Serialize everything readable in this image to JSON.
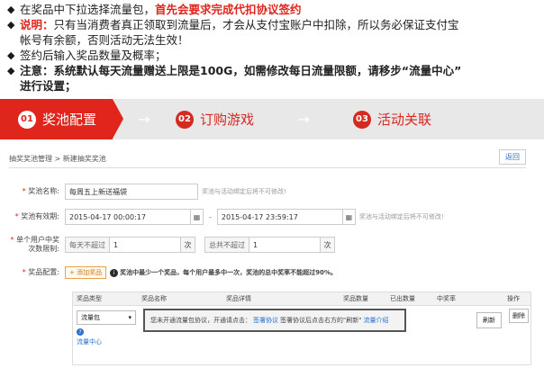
{
  "notes": {
    "n1_plain": "在奖品中下拉选择流量包，",
    "n1_red": "首先会要求完成代扣协议签约",
    "n2_label": "说明：",
    "n2_text": "只有当消费者真正领取到流量后，才会从支付宝账户中扣除，所以务必保证支付宝",
    "n2_text2": "帐号有余额，否则活动无法生效！",
    "n3_text": "签约后输入奖品数量及概率；",
    "n4_label": "注意：",
    "n4_text": "系统默认每天流量赠送上限是100G，如需修改每日流量限额，请移步“流量中心”",
    "n4_text2": "进行设置；"
  },
  "steps": [
    {
      "num": "01",
      "label": "奖池配置"
    },
    {
      "num": "02",
      "label": "订购游戏"
    },
    {
      "num": "03",
      "label": "活动关联"
    }
  ],
  "arrow": "→",
  "breadcrumb": {
    "text": "抽奖奖池管理 > 新建抽奖奖池",
    "back": "返回"
  },
  "form": {
    "name_label": "奖池名称:",
    "name_value": "每周五上新送福袋",
    "name_hint": "奖池与活动绑定后将不可修改!",
    "period_label": "奖池有效期:",
    "start": "2015-04-17 00:00:17",
    "sep": "-",
    "end": "2015-04-17 23:59:17",
    "period_hint": "奖池与活动绑定后将不可修改!",
    "limit_label1": "单个用户中奖",
    "limit_label2": "次数限制:",
    "daily_pre": "每天不超过",
    "daily_val": "1",
    "total_pre": "总共不超过",
    "total_val": "1",
    "unit": "次",
    "prize_label": "奖品配置:",
    "add_btn": "+ 添加奖品",
    "prize_info": "奖池中最少一个奖品，每个用户最多中一次，奖池的总中奖率不能超过90%。"
  },
  "table": {
    "headers": [
      "奖品类型",
      "奖品名称",
      "奖品详情",
      "奖品数量",
      "已出数量",
      "中奖率",
      "操作"
    ],
    "select_value": "流量包",
    "flow_link": "流量中心",
    "alert_pre": "您未开通流量包协议，开通请点击：",
    "alert_link1": "签署协议",
    "alert_mid": "签署协议后点击右方的\"刷新\"",
    "alert_link2": "流量介绍",
    "refresh": "刷新",
    "delete": "删除"
  }
}
